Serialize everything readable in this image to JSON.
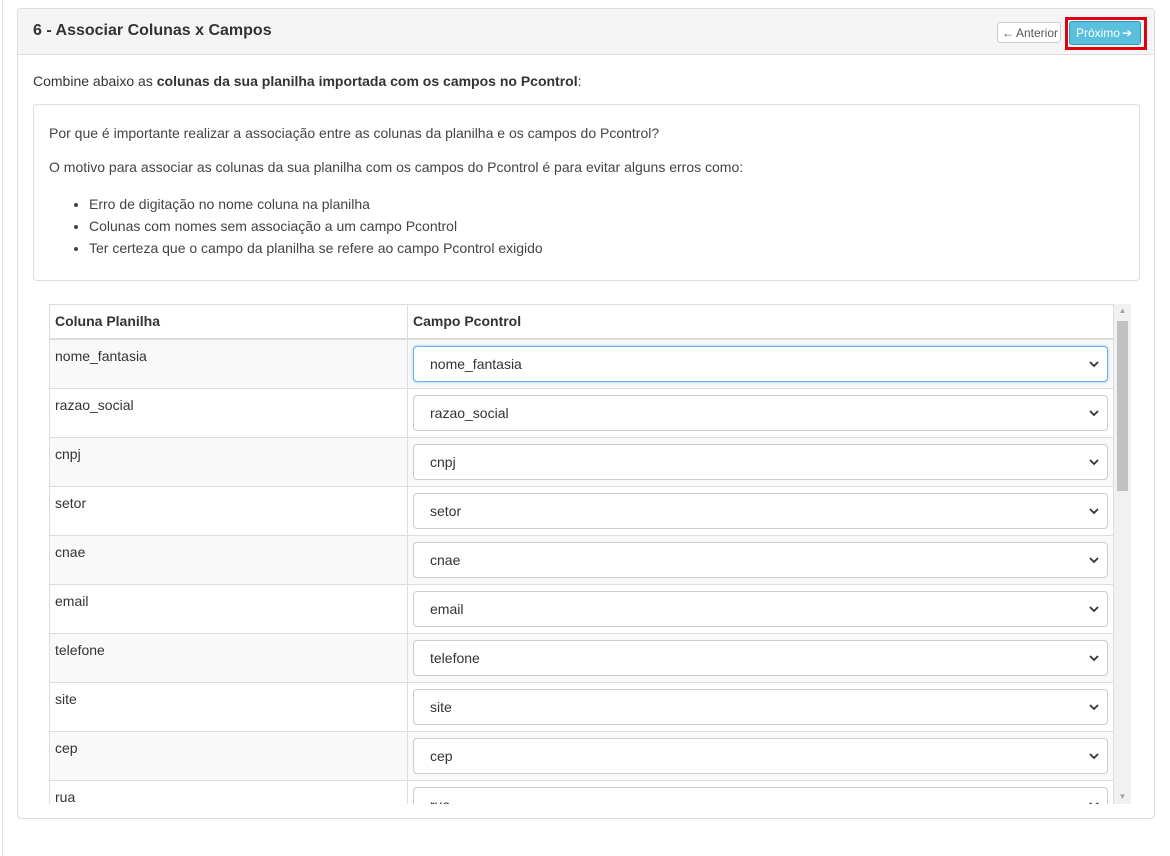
{
  "panel": {
    "title": "6 - Associar Colunas x Campos",
    "prev_label": "Anterior",
    "next_label": "Próximo",
    "prev_icon": "arrow-left-icon",
    "next_icon": "arrow-right-icon",
    "accent_color": "#5bc0de",
    "highlight_color": "#e2000f"
  },
  "intro": {
    "prefix": "Combine abaixo as ",
    "bold": "colunas da sua planilha importada com os campos no Pcontrol",
    "suffix": ":"
  },
  "info": {
    "question": "Por que é importante realizar a associação entre as colunas da planilha e os campos do Pcontrol?",
    "reason": "O motivo para associar as colunas da sua planilha com os campos do Pcontrol é para evitar alguns erros como:",
    "items": [
      "Erro de digitação no nome coluna na planilha",
      "Colunas com nomes sem associação a um campo Pcontrol",
      "Ter certeza que o campo da planilha se refere ao campo Pcontrol exigido"
    ]
  },
  "table": {
    "headers": [
      "Coluna Planilha",
      "Campo Pcontrol"
    ],
    "rows": [
      {
        "column": "nome_fantasia",
        "field": "nome_fantasia"
      },
      {
        "column": "razao_social",
        "field": "razao_social"
      },
      {
        "column": "cnpj",
        "field": "cnpj"
      },
      {
        "column": "setor",
        "field": "setor"
      },
      {
        "column": "cnae",
        "field": "cnae"
      },
      {
        "column": "email",
        "field": "email"
      },
      {
        "column": "telefone",
        "field": "telefone"
      },
      {
        "column": "site",
        "field": "site"
      },
      {
        "column": "cep",
        "field": "cep"
      },
      {
        "column": "rua",
        "field": "rua"
      }
    ]
  }
}
